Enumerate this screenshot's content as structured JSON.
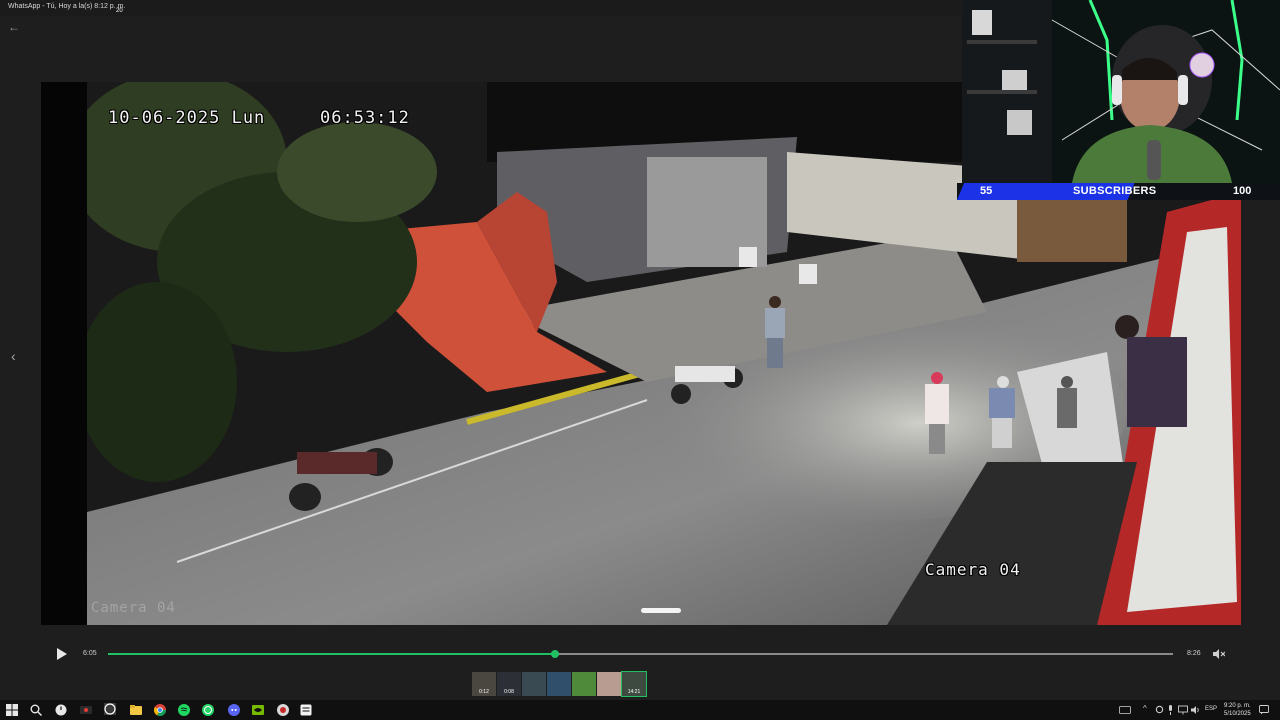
{
  "window": {
    "title": "WhatsApp - Tú, Hoy a la(s) 8:12 p. m."
  },
  "icons": {
    "back": "arrow-left-icon",
    "prev": "chevron-left-icon",
    "play": "play-icon",
    "mute": "speaker-muted-icon"
  },
  "video": {
    "osd_date": "10-06-2025 Lun",
    "osd_time": "06:53:12",
    "osd_camera": "Camera 04",
    "osd_camera_ghost": "Camera 04"
  },
  "overlay": {
    "subscribers_current": "55",
    "subscribers_label": "SUBSCRIBERS",
    "subscribers_goal": "100",
    "subscribers_fraction": 0.55,
    "bar_color": "#1b32e6"
  },
  "player": {
    "current_time": "6:05",
    "duration": "8:26",
    "progress_fraction": 0.42,
    "accent_color": "#21c063"
  },
  "thumbnails": [
    {
      "duration": "0:12"
    },
    {
      "duration": "0:08"
    },
    {
      "duration": ""
    },
    {
      "duration": ""
    },
    {
      "duration": ""
    },
    {
      "duration": ""
    },
    {
      "duration": "14:21"
    }
  ],
  "taskbar": {
    "whatsapp_badge": "20",
    "language": "ESP",
    "time": "9:20 p. m.",
    "date": "5/10/2025"
  }
}
